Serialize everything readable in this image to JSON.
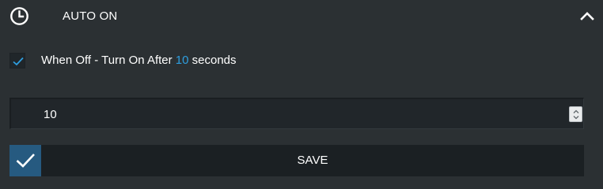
{
  "header": {
    "title": "AUTO ON",
    "icon": "clock-icon",
    "collapse_icon": "chevron-up-icon"
  },
  "auto_on_option": {
    "checked": true,
    "label_prefix": "When Off - Turn On After ",
    "delay_value": "10",
    "label_suffix": " seconds"
  },
  "delay_input": {
    "value": "10"
  },
  "save": {
    "label": "SAVE",
    "icon": "checkmark-icon"
  },
  "colors": {
    "background": "#2b3033",
    "field": "#21262a",
    "accent_blue": "#2e9fe0",
    "save_icon_bg": "#265a80",
    "save_bar": "#1b2023"
  }
}
